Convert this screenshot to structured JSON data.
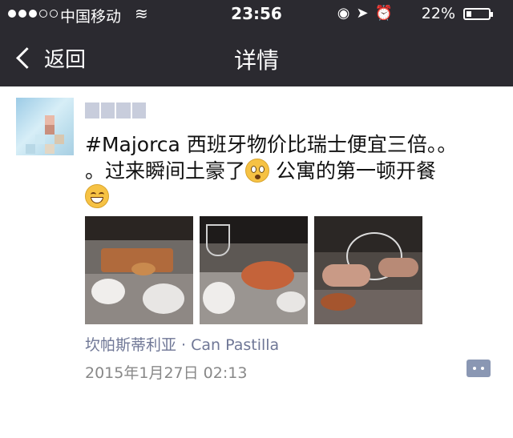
{
  "status_bar": {
    "carrier": "中国移动",
    "time": "23:56",
    "battery": "22%"
  },
  "nav": {
    "back_label": "返回",
    "title": "详情"
  },
  "post": {
    "text_line1": "#Majorca 西班牙物价比瑞士便宜三倍。。",
    "text_line2": "。过来瞬间土豪了",
    "text_line2b": " 公寓的第一顿开餐",
    "location": "坎帕斯蒂利亚 · Can Pastilla",
    "timestamp": "2015年1月27日 02:13"
  }
}
